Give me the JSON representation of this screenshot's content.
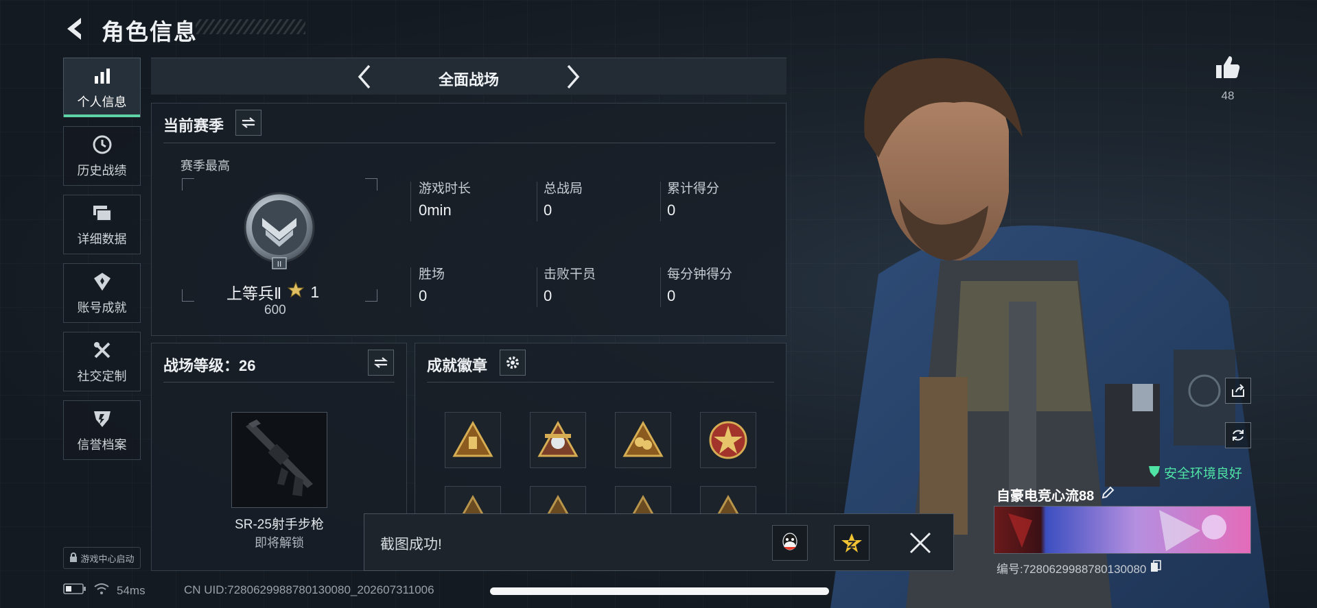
{
  "header": {
    "title": "角色信息"
  },
  "nav": {
    "items": [
      {
        "label": "个人信息",
        "icon": "bar-chart-icon",
        "active": true
      },
      {
        "label": "历史战绩",
        "icon": "clock-icon",
        "active": false
      },
      {
        "label": "详细数据",
        "icon": "folder-icon",
        "active": false
      },
      {
        "label": "账号成就",
        "icon": "achievement-icon",
        "active": false
      },
      {
        "label": "社交定制",
        "icon": "tools-icon",
        "active": false
      },
      {
        "label": "信誉档案",
        "icon": "credit-shield-icon",
        "active": false
      }
    ],
    "game_center": "游戏中心启动"
  },
  "mode": {
    "label": "全面战场"
  },
  "season": {
    "title": "当前赛季",
    "best_label": "赛季最高",
    "rank_name": "上等兵Ⅱ",
    "rank_stars": "1",
    "rank_points": "600",
    "stats": [
      {
        "label": "游戏时长",
        "value": "0min"
      },
      {
        "label": "总战局",
        "value": "0"
      },
      {
        "label": "累计得分",
        "value": "0"
      },
      {
        "label": "胜场",
        "value": "0"
      },
      {
        "label": "击败干员",
        "value": "0"
      },
      {
        "label": "每分钟得分",
        "value": "0"
      }
    ]
  },
  "battlefield": {
    "level_label": "战场等级：26",
    "weapon_name": "SR-25射手步枪",
    "weapon_status": "即将解锁"
  },
  "achievements": {
    "title": "成就徽章",
    "badge_count": 8
  },
  "toast": {
    "message": "截图成功!"
  },
  "profile": {
    "likes": "48",
    "safety_status": "安全环境良好",
    "nickname": "自豪电竞心流88",
    "player_id": "编号:7280629988780130080"
  },
  "statusbar": {
    "ping": "54ms",
    "uid": "CN UID:7280629988780130080_202607311006"
  },
  "colors": {
    "accent": "#5fd3a6",
    "safe_green": "#4fe3a5",
    "badge_gold": "#c9a24a"
  }
}
